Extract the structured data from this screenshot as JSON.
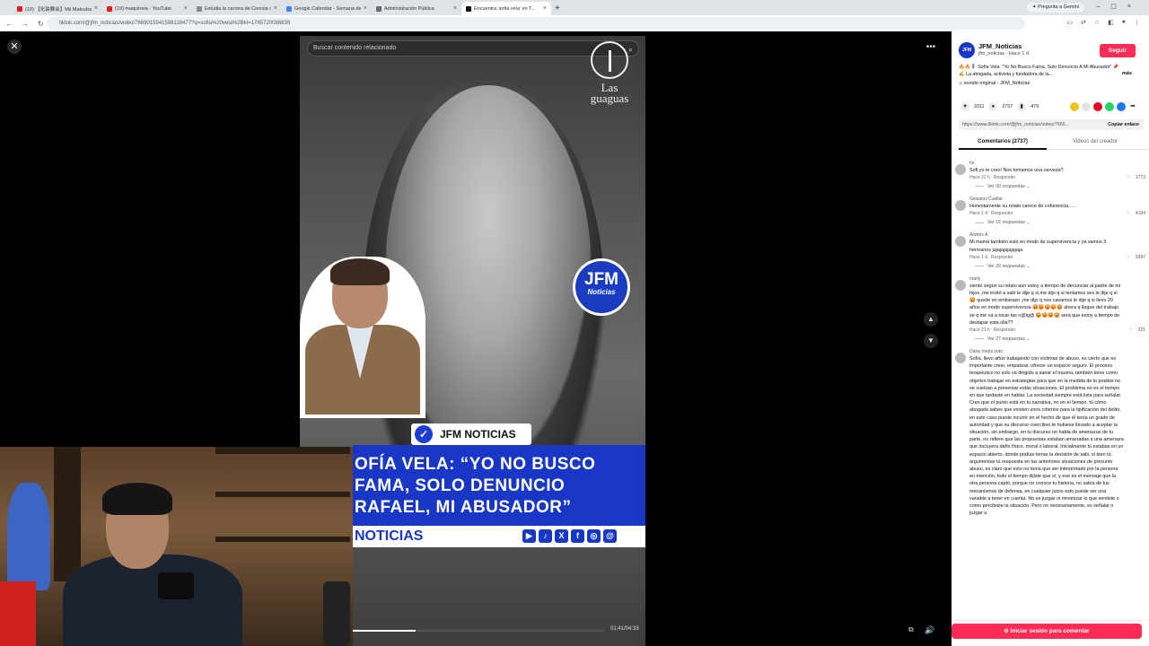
{
  "browser": {
    "tabs": [
      {
        "title": "(19) 【化装舞会】Mii Matsubara",
        "favicon_color": "#e62117"
      },
      {
        "title": "(19) maquineia - YouTube",
        "favicon_color": "#e62117"
      },
      {
        "title": "Estudia la carrera de Ciencia d...",
        "favicon_color": "#8a8a8a"
      },
      {
        "title": "Google Calendar - Semana del",
        "favicon_color": "#4285f4"
      },
      {
        "title": "Administración Pública",
        "favicon_color": "#5f6d7a"
      },
      {
        "title": "Encuentra 'sofia vela' en T...",
        "favicon_color": "#111111"
      }
    ],
    "gemini_label": "Pregunta a Gemini",
    "url": "tiktok.com/@jfm_noticias/video/7669015941598118477?q=sofia%20vela%2Bkt=1765720086839"
  },
  "video": {
    "search_placeholder": "Buscar contenido relacionado",
    "watermark": "Las guaguas",
    "badge_top": "JFM",
    "badge_bottom": "Noticias",
    "brand_tag": "JFM NOTICIAS",
    "headline_lines": [
      "OFÍA VELA: “YO NO BUSCO",
      "FAMA, SOLO DENUNCIO",
      "RAFAEL, MI ABUSADOR”"
    ],
    "footer_brand": "NOTICIAS",
    "social_icons": [
      "youtube-icon",
      "tiktok-icon",
      "x-icon",
      "facebook-icon",
      "instagram-icon",
      "threads-icon"
    ],
    "progress_fraction": 0.25,
    "time": "01:41/04:33"
  },
  "creator": {
    "name": "JFM_Noticias",
    "handle_time": "jfm_noticias · Hace 1 d",
    "follow_label": "Seguir",
    "description": "🔥🔥🧍‍♀️ Sofía Vela: \"Yo No Busco Fama, Solo Denuncio A Mi Abusador\" 📌 ✍️ La abogada, activista y fundadora de la...",
    "more_label": "más",
    "sound": "sonido original - JFM_Noticias",
    "likes": "3311",
    "comments": "2737",
    "saves": "479",
    "link": "https://www.tiktok.com/@jfm_noticias/video/7669...",
    "copy_label": "Copiar enlace"
  },
  "tabs": {
    "comments": "Comentarios (2737)",
    "creator_videos": "Videos del creador"
  },
  "comments": [
    {
      "user": "hs",
      "text": "Sofi yo te creo! Nos tomamos una cerveza?",
      "time": "Hace 22 h",
      "reply": "Responder",
      "likes": "1773",
      "replies": "Ver 60 respuestas"
    },
    {
      "user": "Giovanni Cuellar",
      "text": "Honestamente su relato carece de coherencia......",
      "time": "Hace 1 d",
      "reply": "Responder",
      "likes": "4194",
      "replies": "Ver 16 respuestas"
    },
    {
      "user": "Andrés A",
      "text": "Mi mamá también está en modo de supervivencia y ya vamos 3 hermanos jajajajajajajaja",
      "time": "Hace 1 d",
      "reply": "Responder",
      "likes": "3397",
      "replies": "Ver 20 respuestas"
    },
    {
      "user": "marly",
      "text": "siento según su relato aún estoy a tiempo de denunciar al padre de mi hijos ,me invitó a salir le dije q si,me dijo q si tenlamos sex.le dije q sí 😡 quedé en embarazo ,me dijo q nos casamos le dije q si llevo 20 años en modo supervivencia 😡😡😡😡😡 ahora q llegue del trabajo se q me va a tocar las n@lg@ 😡😡😡😡 será que estoy a tiempo de destapar esta olla??",
      "time": "Hace 21 h",
      "reply": "Responder",
      "likes": "221",
      "replies": "Ver 27 respuestas"
    },
    {
      "user": "Daisy mejía soto",
      "text": "Sofía, llevo años trabajando con víctimas de abuso, es cierto que es importante creer, empatizar, ofrecer un espacio seguro. El proceso terapéutico no solo va dirigido a sanar el trauma, también tiene como objetivo trabajar en estrategias para que en la medida de lo posible no se vuelvan a presentar estás situaciones. El problema no es el tiempo en que tardaste en hablar. La sociedad siempre está lista para señalar. Creo que el punto está en tu narrativa, no en el tiempo, tú cómo abogada sabes que existen unos criterios para la tipificación del delito, en este caso puede incurrir en el hecho de que él tenía un grado de autoridad y que su discurso coercitivo te hubiese llevado a aceptar la situación, sin embargo, en tu discurso no habla de amenazas de tu parte, no refiere que las propuestas estaban amarradas a una amenaza que incluyera daño físico. moral o laboral. Inicialmente tú estabas en un espacio abierto, donde podías tomar la decisión de salir, si bien tú argumentas tú respuesta en las anteriores situaciones de presunto abuso, es claro que esto no tenía que ser interpretado por la persona en mención, todo el tiempo dijiste que sí, y ese es el mensaje que la otra persona captó, porque no conoce tu historia, no sabía de tus mecanismos de defensa, en cualquier juicio esto puede ser una variable a tener en cuenta. No es juzgar ni minimizar lo que sentiste o como percibiste la situación. Pero no necesariamente, es señalar o juzgar a",
      "time": "",
      "reply": "",
      "likes": "",
      "replies": ""
    }
  ],
  "login_label": "Iniciar sesión para comentar"
}
